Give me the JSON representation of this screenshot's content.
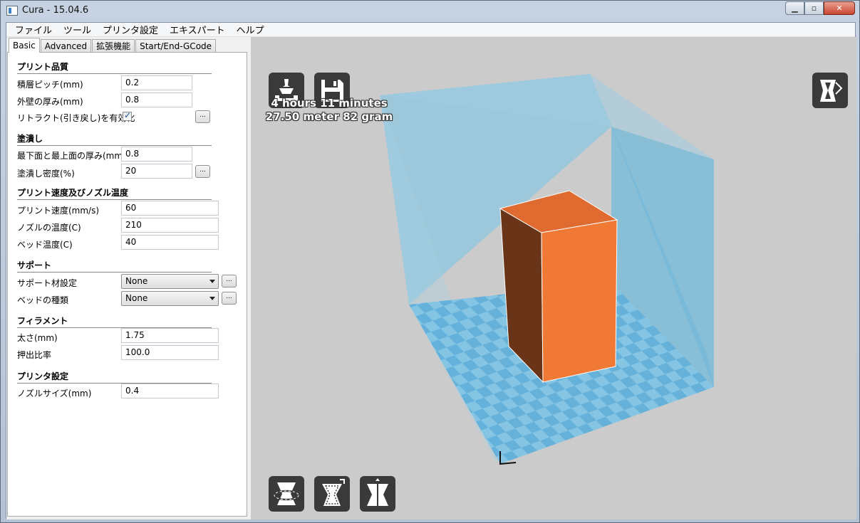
{
  "window": {
    "title": "Cura - 15.04.6"
  },
  "menu": [
    "ファイル",
    "ツール",
    "プリンタ設定",
    "エキスパート",
    "ヘルプ"
  ],
  "tabs": [
    "Basic",
    "Advanced",
    "拡張機能",
    "Start/End-GCode"
  ],
  "sections": {
    "quality": "プリント品質",
    "fill": "塗潰し",
    "speed": "プリント速度及びノズル温度",
    "support": "サポート",
    "filament": "フィラメント",
    "machine": "プリンタ設定"
  },
  "fields": {
    "layer_height": {
      "label": "積層ピッチ(mm)",
      "value": "0.2"
    },
    "shell_thickness": {
      "label": "外壁の厚み(mm)",
      "value": "0.8"
    },
    "retraction": {
      "label": "リトラクト(引き戻し)を有効化",
      "checked": true
    },
    "bottom_top": {
      "label": "最下面と最上面の厚み(mm)",
      "value": "0.8"
    },
    "fill_density": {
      "label": "塗潰し密度(%)",
      "value": "20"
    },
    "print_speed": {
      "label": "プリント速度(mm/s)",
      "value": "60"
    },
    "nozzle_temp": {
      "label": "ノズルの温度(C)",
      "value": "210"
    },
    "bed_temp": {
      "label": "ベッド温度(C)",
      "value": "40"
    },
    "support_type": {
      "label": "サポート材設定",
      "value": "None"
    },
    "adhesion": {
      "label": "ベッドの種類",
      "value": "None"
    },
    "diameter": {
      "label": "太さ(mm)",
      "value": "1.75"
    },
    "flow": {
      "label": "押出比率",
      "value": "100.0"
    },
    "nozzle_size": {
      "label": "ノズルサイズ(mm)",
      "value": "0.4"
    }
  },
  "dots_label": "...",
  "print_info": {
    "time": "4 hours 11 minutes",
    "material": "27.50 meter 82 gram"
  },
  "colors": {
    "model_front": "#f07a35",
    "model_side": "#6a3418",
    "model_top": "#e06b30",
    "volume": "#6cb8dc",
    "grid": "#5aaedc"
  }
}
